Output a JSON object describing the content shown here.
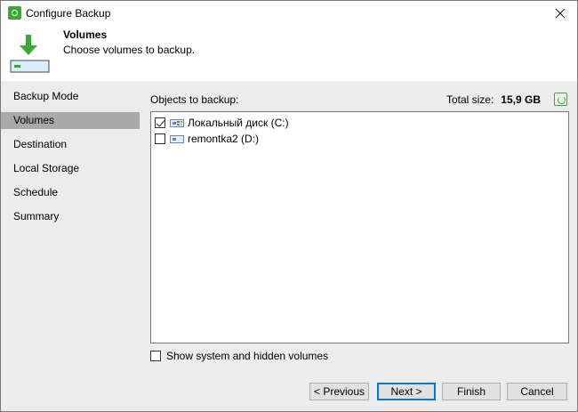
{
  "window": {
    "title": "Configure Backup"
  },
  "header": {
    "title": "Volumes",
    "subtitle": "Choose volumes to backup."
  },
  "sidebar": {
    "items": [
      {
        "label": "Backup Mode",
        "active": false
      },
      {
        "label": "Volumes",
        "active": true
      },
      {
        "label": "Destination",
        "active": false
      },
      {
        "label": "Local Storage",
        "active": false
      },
      {
        "label": "Schedule",
        "active": false
      },
      {
        "label": "Summary",
        "active": false
      }
    ]
  },
  "content": {
    "objects_label": "Objects to backup:",
    "total_size_label": "Total size:",
    "total_size_value": "15,9 GB",
    "volumes": [
      {
        "label": "Локальный диск (C:)",
        "checked": true,
        "system": true
      },
      {
        "label": "remontka2 (D:)",
        "checked": false,
        "system": false
      }
    ],
    "show_hidden_label": "Show system and hidden volumes",
    "show_hidden_checked": false
  },
  "footer": {
    "previous_label": "< Previous",
    "next_label": "Next >",
    "finish_label": "Finish",
    "cancel_label": "Cancel"
  },
  "colors": {
    "accent": "#3aaa35",
    "selection": "#a9a9a9",
    "panel": "#ececec",
    "focus": "#0078d7"
  }
}
